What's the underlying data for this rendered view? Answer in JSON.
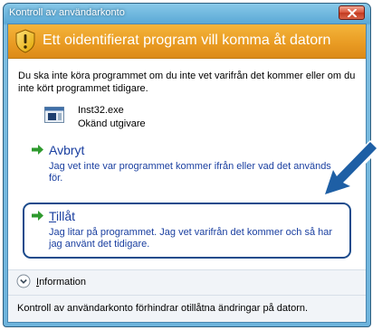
{
  "window": {
    "title": "Kontroll av användarkonto"
  },
  "banner": {
    "text": "Ett oidentifierat program vill komma åt datorn"
  },
  "message": "Du ska inte köra programmet om du inte vet varifrån det kommer eller om du inte kört programmet tidigare.",
  "app": {
    "name": "Inst32.exe",
    "publisher": "Okänd utgivare"
  },
  "options": {
    "cancel": {
      "title": "Avbryt",
      "description": "Jag vet inte var programmet kommer ifrån eller vad det används för."
    },
    "allow": {
      "title_accel": "T",
      "title_rest": "illåt",
      "description": "Jag litar på programmet. Jag vet varifrån det kommer och så har jag använt det tidigare."
    }
  },
  "details": {
    "label_accel": "I",
    "label_rest": "nformation"
  },
  "footer": {
    "text": "Kontroll av användarkonto förhindrar otillåtna ändringar på datorn."
  },
  "colors": {
    "accent_link": "#1a3fa0",
    "banner_orange": "#e89a22",
    "highlight_frame": "#1c4b8c",
    "callout_arrow": "#1e5fa5"
  },
  "icons": {
    "banner": "shield-warning-icon",
    "app": "application-icon",
    "option_arrow": "green-arrow-icon",
    "expand": "chevron-down-circle-icon",
    "close": "close-icon",
    "callout": "callout-arrow"
  }
}
